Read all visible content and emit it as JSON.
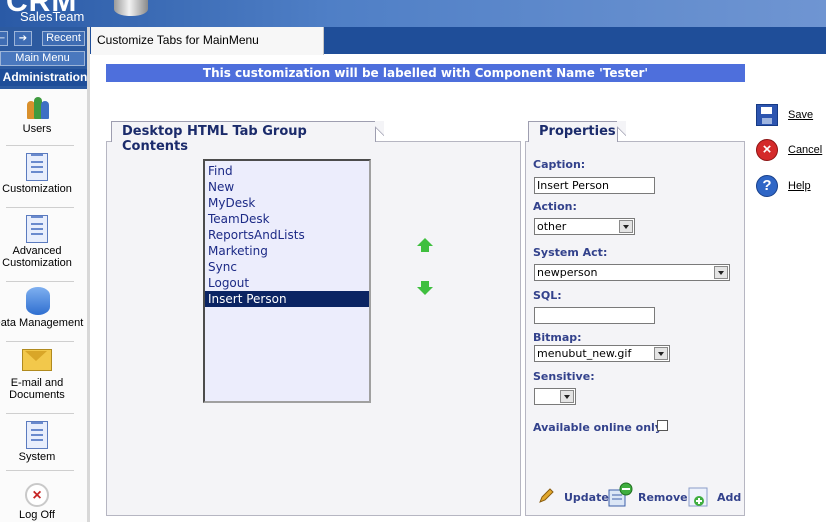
{
  "app": {
    "logo_main": "CRM",
    "logo_sub": "SalesTeam"
  },
  "nav": {
    "back_symbol": "←",
    "forward_symbol": "➔",
    "recent_label": "Recent",
    "main_menu_label": "Main Menu",
    "section_label": "Administration"
  },
  "sidebar": {
    "items": [
      {
        "label": "Users",
        "icon": "users-icon"
      },
      {
        "label": "Customization",
        "icon": "customization-icon"
      },
      {
        "label": "Advanced Customization",
        "icon": "advanced-customization-icon"
      },
      {
        "label": "Data Management",
        "icon": "data-management-icon"
      },
      {
        "label": "E-mail and Documents",
        "icon": "email-icon"
      },
      {
        "label": "System",
        "icon": "system-icon"
      },
      {
        "label": "Log Off",
        "icon": "logoff-icon"
      }
    ]
  },
  "tab": {
    "active_label": "Customize Tabs for MainMenu"
  },
  "banner": {
    "text": "This customization will be labelled with Component Name 'Tester'"
  },
  "contents_panel": {
    "title": "Desktop HTML Tab Group Contents",
    "items": [
      "Find",
      "New",
      "MyDesk",
      "TeamDesk",
      "ReportsAndLists",
      "Marketing",
      "Sync",
      "Logout",
      "Insert Person"
    ],
    "selected_index": 8
  },
  "properties_panel": {
    "title": "Properties",
    "caption_label": "Caption:",
    "caption_value": "Insert Person",
    "action_label": "Action:",
    "action_value": "other",
    "system_act_label": "System Act:",
    "system_act_value": "newperson",
    "sql_label": "SQL:",
    "sql_value": "",
    "bitmap_label": "Bitmap:",
    "bitmap_value": "menubut_new.gif",
    "sensitive_label": "Sensitive:",
    "sensitive_value": "",
    "online_label": "Available online only:",
    "online_checked": false,
    "update_label": "Update",
    "remove_label": "Remove",
    "add_label": "Add"
  },
  "page_actions": {
    "save_label": "Save",
    "cancel_label": "Cancel",
    "help_label": "Help"
  },
  "colors": {
    "header_blue": "#2a5aa6",
    "tabbar_blue": "#1f4e99",
    "banner_blue": "#4e6fdc",
    "list_bg": "#ecedfc",
    "selected_bg": "#0b2463",
    "label_text": "#33428c"
  }
}
